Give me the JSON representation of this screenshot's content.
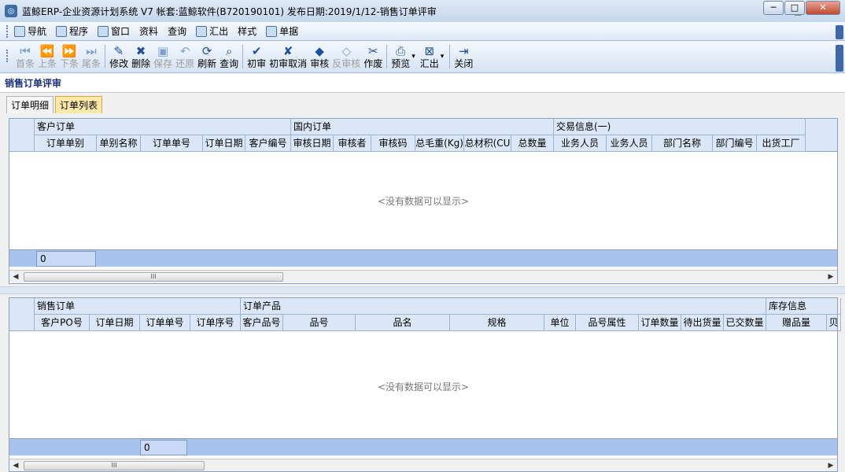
{
  "window": {
    "title": "蓝鲸ERP-企业资源计划系统 V7 帐套:蓝鲸软件(B720190101) 发布日期:2019/1/12-销售订单评审",
    "minimize": "─",
    "maximize": "□",
    "close": "✕"
  },
  "menu": [
    {
      "label": "导航",
      "icon": "navigation-icon"
    },
    {
      "label": "程序",
      "icon": "program-icon"
    },
    {
      "label": "窗口",
      "icon": "window-icon"
    },
    {
      "label": "资料",
      "icon": ""
    },
    {
      "label": "查询",
      "icon": ""
    },
    {
      "label": "汇出",
      "icon": "export-folder-icon"
    },
    {
      "label": "样式",
      "icon": ""
    },
    {
      "label": "单据",
      "icon": "document-icon"
    }
  ],
  "toolbar": [
    {
      "label": "首条",
      "icon": "first-record-icon",
      "glyph": "⏮",
      "enabled": false
    },
    {
      "label": "上条",
      "icon": "previous-record-icon",
      "glyph": "⏪",
      "enabled": false
    },
    {
      "label": "下条",
      "icon": "next-record-icon",
      "glyph": "⏩",
      "enabled": false
    },
    {
      "label": "尾条",
      "icon": "last-record-icon",
      "glyph": "⏭",
      "enabled": false
    },
    {
      "label": "修改",
      "icon": "edit-icon",
      "glyph": "✎",
      "enabled": true
    },
    {
      "label": "删除",
      "icon": "delete-icon",
      "glyph": "✖",
      "enabled": true
    },
    {
      "label": "保存",
      "icon": "save-icon",
      "glyph": "▣",
      "enabled": false
    },
    {
      "label": "还原",
      "icon": "undo-icon",
      "glyph": "↶",
      "enabled": false
    },
    {
      "label": "刷新",
      "icon": "refresh-icon",
      "glyph": "⟳",
      "enabled": true
    },
    {
      "label": "查询",
      "icon": "query-icon",
      "glyph": "⌕",
      "enabled": true
    },
    {
      "label": "初审",
      "icon": "initial-review-icon",
      "glyph": "✔",
      "enabled": true
    },
    {
      "label": "初审取消",
      "icon": "cancel-initial-review-icon",
      "glyph": "✘",
      "enabled": true
    },
    {
      "label": "审核",
      "icon": "approve-icon",
      "glyph": "◆",
      "enabled": true
    },
    {
      "label": "反审核",
      "icon": "unapprove-icon",
      "glyph": "◇",
      "enabled": false
    },
    {
      "label": "作废",
      "icon": "void-icon",
      "glyph": "✂",
      "enabled": true
    },
    {
      "label": "预览",
      "icon": "print-preview-icon",
      "glyph": "⎙",
      "enabled": true
    },
    {
      "label": "汇出",
      "icon": "export-icon",
      "glyph": "⊠",
      "enabled": true
    },
    {
      "label": "关闭",
      "icon": "close-door-icon",
      "glyph": "⇥",
      "enabled": true
    }
  ],
  "page": {
    "caption": "销售订单评审",
    "tabs": [
      {
        "label": "订单明细",
        "active": false
      },
      {
        "label": "订单列表",
        "active": true
      }
    ]
  },
  "upper_grid": {
    "groups": [
      "客户订单",
      "国内订单",
      "交易信息(一)"
    ],
    "columns": [
      "订单单别",
      "单别名称",
      "订单单号",
      "订单日期",
      "客户编号",
      "审核日期",
      "审核者",
      "审核码",
      "总毛重(Kg)",
      "总材积(CU",
      "总数量",
      "业务人员",
      "业务人员",
      "部门名称",
      "部门编号",
      "出货工厂"
    ],
    "empty_text": "<没有数据可以显示>",
    "summary": "0",
    "scroll_thumb": "III"
  },
  "lower_grid": {
    "groups": [
      "销售订单",
      "订单产品",
      "库存信息"
    ],
    "columns": [
      "客户PO号",
      "订单日期",
      "订单单号",
      "订单序号",
      "客户品号",
      "品号",
      "品名",
      "规格",
      "单位",
      "品号属性",
      "订单数量",
      "待出货量",
      "已交数量",
      "赠品量",
      "贝"
    ],
    "empty_text": "<没有数据可以显示>",
    "summary": "0",
    "scroll_thumb": "III"
  }
}
